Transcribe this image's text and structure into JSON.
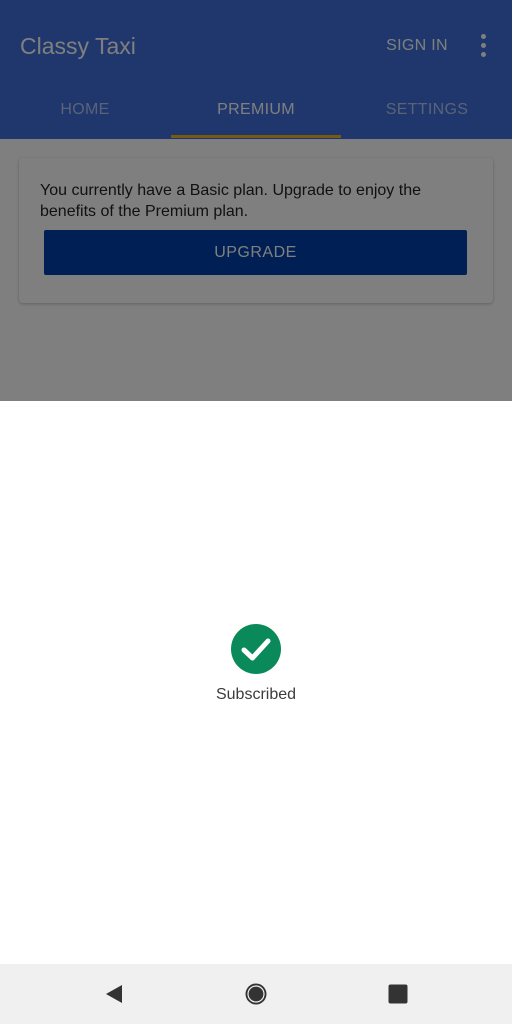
{
  "app": {
    "title": "Classy Taxi",
    "sign_in_label": "SIGN IN",
    "overflow_icon": "more-vert-icon",
    "tabs": [
      {
        "label": "HOME",
        "active": false
      },
      {
        "label": "PREMIUM",
        "active": true
      },
      {
        "label": "SETTINGS",
        "active": false
      }
    ],
    "plan_card": {
      "message": "You currently have a Basic plan. Upgrade to enjoy the benefits of the Premium plan.",
      "upgrade_label": "UPGRADE"
    }
  },
  "sheet": {
    "status_icon": "check-circle-icon",
    "status_text": "Subscribed"
  },
  "system_nav": {
    "back_icon": "back-triangle-icon",
    "home_icon": "home-circle-icon",
    "recents_icon": "recents-square-icon"
  },
  "colors": {
    "app_bar": "#3f6fd8",
    "tab_indicator": "#f0b323",
    "upgrade_button": "#003fa8",
    "success_green": "#0a8a5a",
    "nav_bar": "#f0f0f0"
  }
}
